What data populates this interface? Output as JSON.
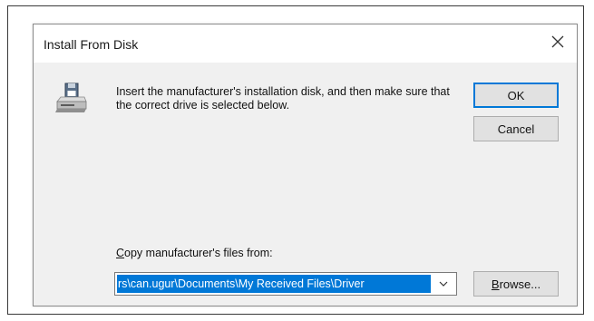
{
  "dialog": {
    "title": "Install From Disk",
    "close_icon": "close-icon",
    "message": "Insert the manufacturer's installation disk, and then make sure that the correct drive is selected below.",
    "disk_icon": "floppy-disk-drive-icon",
    "ok_label": "OK",
    "cancel_label": "Cancel",
    "copy_label_mnemonic": "C",
    "copy_label_rest": "opy manufacturer's files from:",
    "path_value": "rs\\can.ugur\\Documents\\My Received Files\\Driver",
    "dropdown_icon": "chevron-down-icon",
    "browse_mnemonic": "B",
    "browse_rest": "rowse...",
    "accent_color": "#0078d7"
  }
}
